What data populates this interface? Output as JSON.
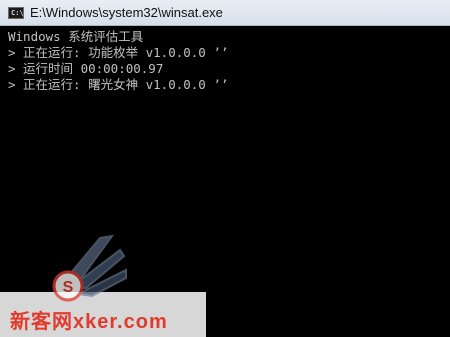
{
  "window": {
    "title": "E:\\Windows\\system32\\winsat.exe",
    "icon_label": "C:\\"
  },
  "console": {
    "lines": [
      "Windows 系统评估工具",
      "> 正在运行: 功能枚举 v1.0.0.0 ’’",
      "> 运行时间 00:00:00.97",
      "> 正在运行: 曙光女神 v1.0.0.0 ’’"
    ]
  },
  "watermark": {
    "text": "新客网xker.com"
  },
  "colors": {
    "console_bg": "#000000",
    "console_text": "#c0c0c0",
    "watermark_red": "#e23b2e"
  }
}
